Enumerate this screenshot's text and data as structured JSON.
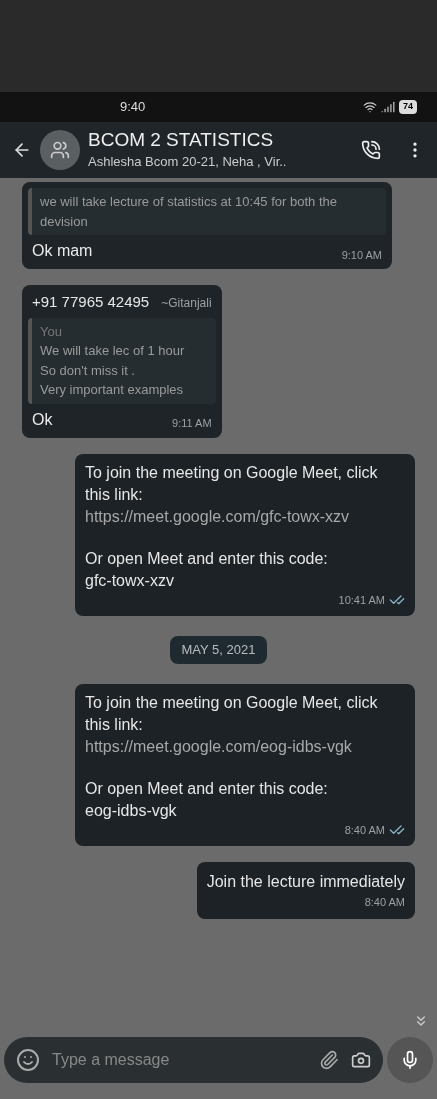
{
  "status_bar": {
    "time": "9:40",
    "battery": "74"
  },
  "header": {
    "title": "BCOM 2 STATISTICS",
    "subtitle": "Ashlesha Bcom 20-21, Neha , Vir.."
  },
  "messages": [
    {
      "kind": "incoming",
      "quote": {
        "text": "we will take lecture of statistics at 10:45 for both the devision"
      },
      "text": "Ok mam",
      "time": "9:10 AM"
    },
    {
      "kind": "incoming",
      "sender": "+91 77965 42495",
      "sender_name": "~Gitanjali",
      "quote": {
        "author": "You",
        "text": "We will take lec of 1 hour\nSo don't miss it .\nVery important examples"
      },
      "text": "Ok",
      "time": "9:11 AM"
    },
    {
      "kind": "outgoing",
      "lines": [
        "To join the meeting on Google Meet, click this link:"
      ],
      "link": "https://meet.google.com/gfc-towx-xzv",
      "after": "Or open Meet and enter this code:\ngfc-towx-xzv",
      "time": "10:41 AM",
      "read": true
    },
    {
      "kind": "date",
      "text": "MAY 5, 2021"
    },
    {
      "kind": "outgoing",
      "lines": [
        "To join the meeting on Google Meet, click this link:"
      ],
      "link": "https://meet.google.com/eog-idbs-vgk",
      "after": "Or open Meet and enter this code:\neog-idbs-vgk",
      "time": "8:40 AM",
      "read": true
    },
    {
      "kind": "outgoing",
      "text": "Join the lecture immediately",
      "time": "8:40 AM"
    }
  ],
  "composer": {
    "placeholder": "Type a message"
  }
}
